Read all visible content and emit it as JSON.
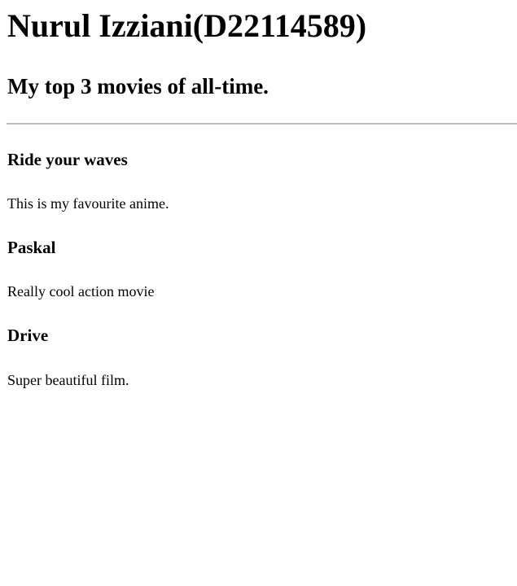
{
  "header": {
    "title": "Nurul Izziani(D22114589)",
    "subtitle": "My top 3 movies of all-time."
  },
  "movies": [
    {
      "title": "Ride your waves",
      "description": "This is my favourite anime."
    },
    {
      "title": "Paskal",
      "description": "Really cool action movie"
    },
    {
      "title": "Drive",
      "description": "Super beautiful film."
    }
  ]
}
